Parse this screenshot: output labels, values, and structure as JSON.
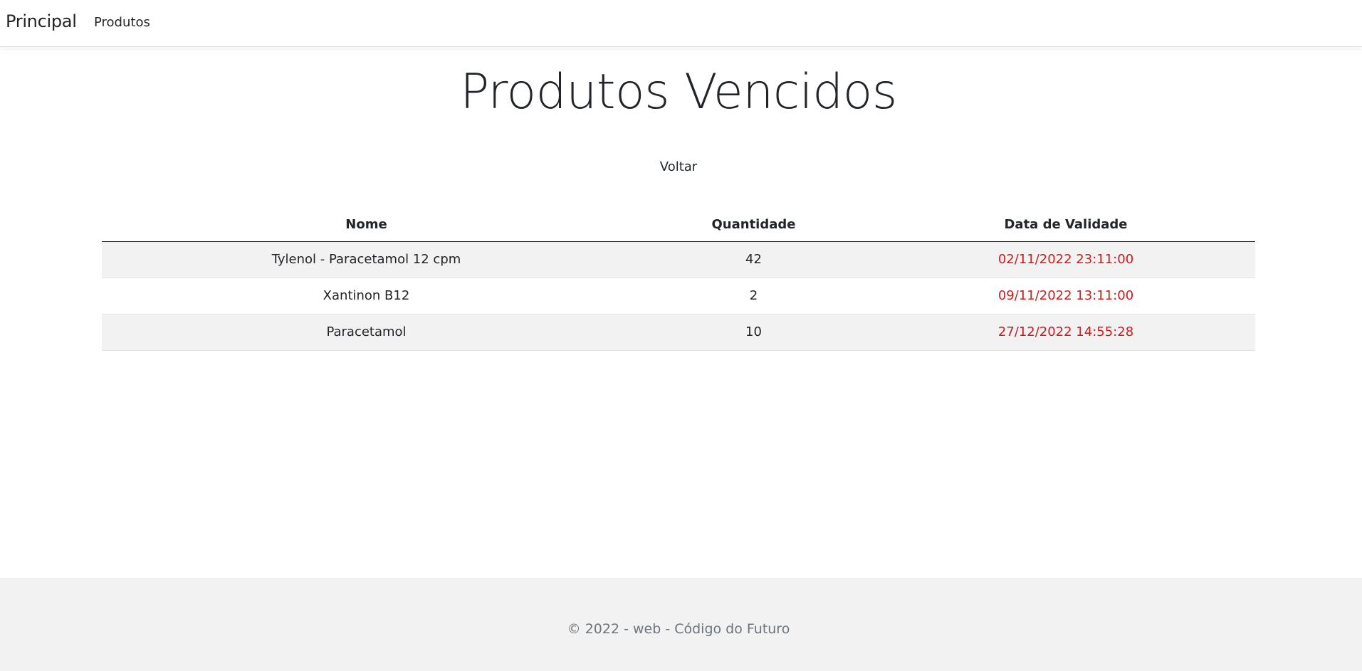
{
  "navbar": {
    "brand": "Principal",
    "links": [
      {
        "label": "Produtos"
      }
    ]
  },
  "main": {
    "title": "Produtos Vencidos",
    "back_label": "Voltar",
    "table": {
      "headers": [
        "Nome",
        "Quantidade",
        "Data de Validade"
      ],
      "rows": [
        {
          "nome": "Tylenol - Paracetamol 12 cpm",
          "quantidade": "42",
          "validade": "02/11/2022 23:11:00"
        },
        {
          "nome": "Xantinon B12",
          "quantidade": "2",
          "validade": "09/11/2022 13:11:00"
        },
        {
          "nome": "Paracetamol",
          "quantidade": "10",
          "validade": "27/12/2022 14:55:28"
        }
      ]
    }
  },
  "footer": {
    "text": "© 2022 - web - Código do Futuro"
  },
  "colors": {
    "expired_date": "#d11a1a",
    "striped_row": "#f2f2f2",
    "footer_bg": "#f2f2f2"
  }
}
